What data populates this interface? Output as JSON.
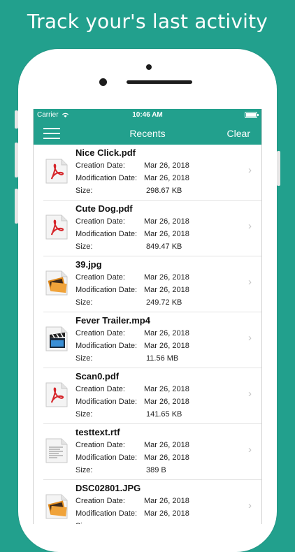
{
  "headline": "Track your's last activity",
  "status": {
    "carrier": "Carrier",
    "time": "10:46 AM"
  },
  "nav": {
    "title": "Recents",
    "clear": "Clear"
  },
  "labels": {
    "creation": "Creation Date:",
    "modification": "Modification Date:",
    "size": "Size:"
  },
  "colors": {
    "brand": "#22a08d"
  },
  "files": [
    {
      "name": "Nice Click.pdf",
      "created": "Mar 26, 2018",
      "modified": "Mar 26, 2018",
      "size": "298.67 KB",
      "icon": "pdf-icon"
    },
    {
      "name": "Cute Dog.pdf",
      "created": "Mar 26, 2018",
      "modified": "Mar 26, 2018",
      "size": "849.47 KB",
      "icon": "pdf-icon"
    },
    {
      "name": "39.jpg",
      "created": "Mar 26, 2018",
      "modified": "Mar 26, 2018",
      "size": "249.72 KB",
      "icon": "image-icon"
    },
    {
      "name": "Fever Trailer.mp4",
      "created": "Mar 26, 2018",
      "modified": "Mar 26, 2018",
      "size": "11.56 MB",
      "icon": "video-icon"
    },
    {
      "name": "Scan0.pdf",
      "created": "Mar 26, 2018",
      "modified": "Mar 26, 2018",
      "size": "141.65 KB",
      "icon": "pdf-icon"
    },
    {
      "name": "testtext.rtf",
      "created": "Mar 26, 2018",
      "modified": "Mar 26, 2018",
      "size": "389 B",
      "icon": "text-document-icon"
    },
    {
      "name": "DSC02801.JPG",
      "created": "Mar 26, 2018",
      "modified": "Mar 26, 2018",
      "size": "",
      "icon": "image-icon"
    }
  ]
}
